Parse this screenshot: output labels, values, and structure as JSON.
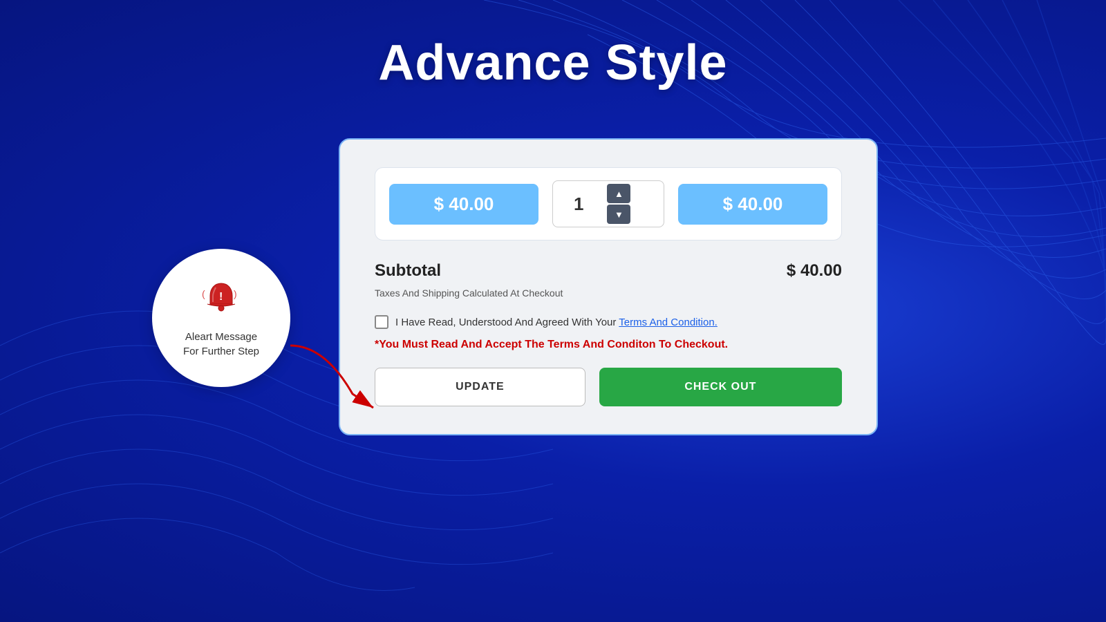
{
  "page": {
    "title": "Advance Style",
    "background_color": "#0a1fa8"
  },
  "alert_bubble": {
    "text_line1": "Aleart Message",
    "text_line2": "For Further Step"
  },
  "product_row": {
    "unit_price": "$ 40.00",
    "quantity": "1",
    "total_price": "$ 40.00",
    "qty_up_label": "▲",
    "qty_down_label": "▼"
  },
  "subtotal": {
    "label": "Subtotal",
    "value": "$ 40.00",
    "tax_note": "Taxes And Shipping Calculated At Checkout"
  },
  "terms": {
    "checkbox_label": "I Have Read, Understood And Agreed With Your",
    "link_text": "Terms And Condition.",
    "error_message": "*You Must Read And Accept The Terms And Conditon To Checkout."
  },
  "buttons": {
    "update_label": "UPDATE",
    "checkout_label": "CHECK OUT"
  }
}
